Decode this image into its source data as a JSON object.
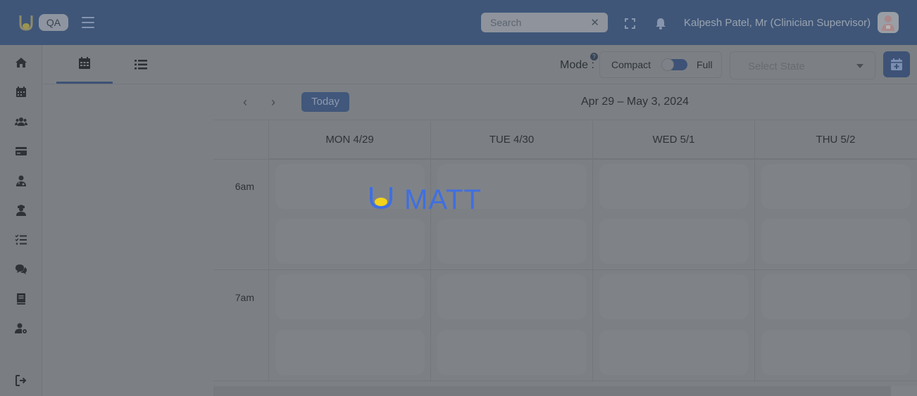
{
  "header": {
    "env_badge": "QA",
    "search_placeholder": "Search",
    "search_clear": "✕",
    "user_name": "Kalpesh Patel, Mr (Clinician Supervisor)"
  },
  "sidebar": {
    "items": [
      {
        "name": "home",
        "icon": "home-icon"
      },
      {
        "name": "calendar",
        "icon": "calendar-icon"
      },
      {
        "name": "clients",
        "icon": "users-icon"
      },
      {
        "name": "billing",
        "icon": "credit-card-icon"
      },
      {
        "name": "clinician",
        "icon": "user-doctor-icon"
      },
      {
        "name": "staff",
        "icon": "user-nurse-icon"
      },
      {
        "name": "tasks",
        "icon": "checklist-icon"
      },
      {
        "name": "messages",
        "icon": "chat-icon"
      },
      {
        "name": "docs",
        "icon": "book-icon"
      },
      {
        "name": "user-settings",
        "icon": "user-gear-icon"
      },
      {
        "name": "logout",
        "icon": "logout-icon"
      }
    ]
  },
  "toolbar": {
    "mode_label": "Mode :",
    "help": "?",
    "compact_label": "Compact",
    "full_label": "Full",
    "state_placeholder": "Select State"
  },
  "calendar": {
    "today_label": "Today",
    "prev": "‹",
    "next": "›",
    "range": "Apr 29 – May 3, 2024",
    "days": [
      "MON 4/29",
      "TUE 4/30",
      "WED 5/1",
      "THU 5/2"
    ],
    "times": [
      "6am",
      "7am"
    ]
  },
  "loader": {
    "brand": "MATT",
    "colors": {
      "blue": "#3f6fe0",
      "yellow": "#f2d21b"
    }
  },
  "colors": {
    "topbar": "#3f5678",
    "accent": "#3d5276",
    "overlay": "#7c8084"
  }
}
